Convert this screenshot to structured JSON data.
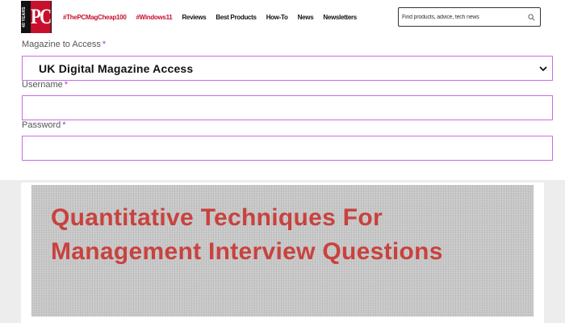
{
  "header": {
    "logo": {
      "years_text": "40 YEARS",
      "brand": "PC"
    },
    "nav": [
      {
        "label": "#ThePCMagCheap100",
        "style": "hash"
      },
      {
        "label": "#Windows11",
        "style": "hash"
      },
      {
        "label": "Reviews",
        "style": "plain"
      },
      {
        "label": "Best Products",
        "style": "plain"
      },
      {
        "label": "How-To",
        "style": "plain"
      },
      {
        "label": "News",
        "style": "plain"
      },
      {
        "label": "Newsletters",
        "style": "plain"
      }
    ],
    "search": {
      "placeholder": "Find products, advice, tech news",
      "icon": "search-icon"
    }
  },
  "form": {
    "magazine_label": "Magazine to Access",
    "magazine_value": "UK Digital Magazine Access",
    "username_label": "Username",
    "password_label": "Password",
    "required_mark": "*"
  },
  "ad": {
    "title": "Quantitative Techniques For Management Interview Questions"
  },
  "colors": {
    "brand_red": "#c8102e",
    "focus_border": "#c66ee6",
    "ad_text": "#c8423e"
  }
}
